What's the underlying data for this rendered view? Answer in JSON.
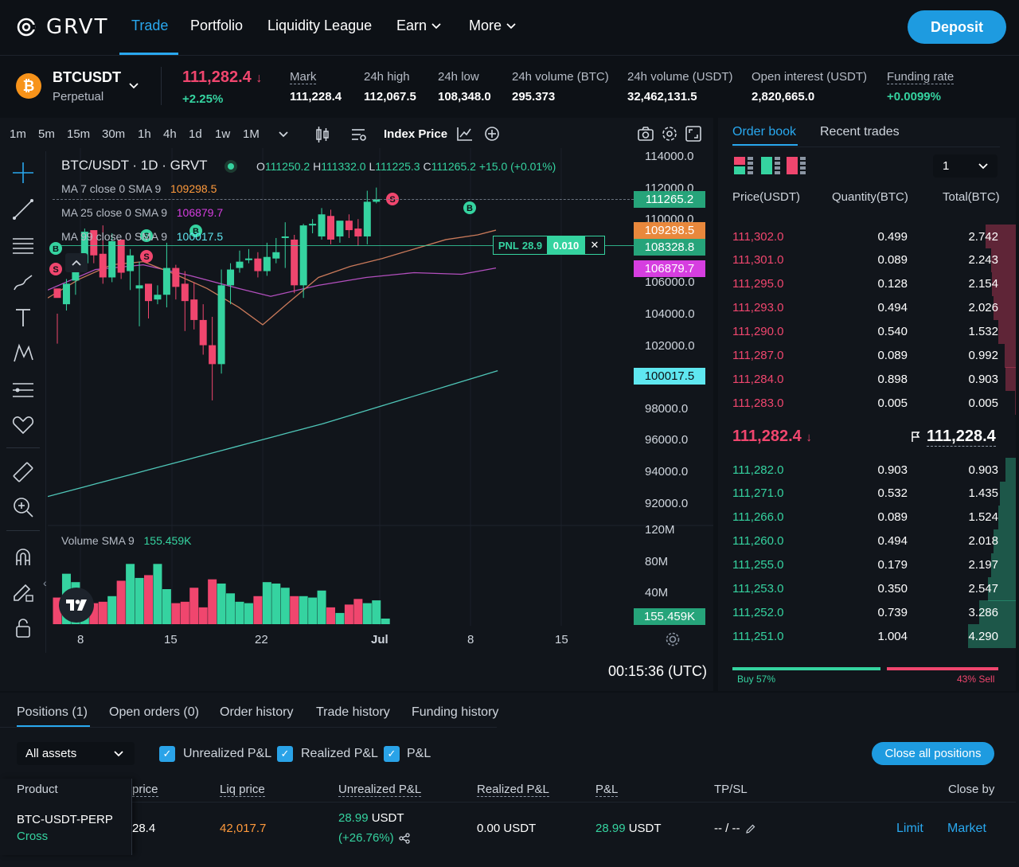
{
  "nav": {
    "logo": "GRVT",
    "items": [
      {
        "label": "Trade",
        "active": true
      },
      {
        "label": "Portfolio"
      },
      {
        "label": "Liquidity League"
      },
      {
        "label": "Earn",
        "dropdown": true
      },
      {
        "label": "More",
        "dropdown": true
      }
    ],
    "deposit": "Deposit"
  },
  "ticker": {
    "symbol": "BTCUSDT",
    "type": "Perpetual",
    "price": "111,282.4",
    "change": "+2.25%",
    "stats": [
      {
        "label": "Mark",
        "value": "111,228.4"
      },
      {
        "label": "24h high",
        "value": "112,067.5"
      },
      {
        "label": "24h low",
        "value": "108,348.0"
      },
      {
        "label": "24h volume (BTC)",
        "value": "295.373"
      },
      {
        "label": "24h volume (USDT)",
        "value": "32,462,131.5"
      },
      {
        "label": "Open interest (USDT)",
        "value": "2,820,665.0"
      },
      {
        "label": "Funding rate",
        "value": "+0.0099%"
      }
    ]
  },
  "chart": {
    "timeframes": [
      "1m",
      "5m",
      "15m",
      "30m",
      "1h",
      "4h",
      "1d",
      "1w",
      "1M"
    ],
    "active_tf": "1d",
    "index_price": "Index Price",
    "legend_title": "BTC/USDT · 1D · GRVT",
    "ohlc": {
      "o_label": "O",
      "o": "111250.2",
      "h_label": "H",
      "h": "111332.0",
      "l_label": "L",
      "l": "111225.3",
      "c_label": "C",
      "c": "111265.2",
      "chg": "+15.0 (+0.01%)"
    },
    "ma1": {
      "label": "MA 7 close 0 SMA 9",
      "value": "109298.5"
    },
    "ma2": {
      "label": "MA 25 close 0 SMA 9",
      "value": "106879.7"
    },
    "ma3": {
      "label": "MA 99 close 0 SMA 9",
      "value": "100017.5"
    },
    "price_axis": [
      "114000.0",
      "112000.0",
      "110000.0",
      "108000.0",
      "106000.0",
      "104000.0",
      "102000.0",
      "100000.0",
      "98000.0",
      "96000.0",
      "94000.0",
      "92000.0"
    ],
    "price_tags": {
      "last": "111265.2",
      "ma7": "109298.5",
      "pos": "108328.8",
      "ma25": "106879.7",
      "ma99": "100017.5"
    },
    "pnl": {
      "label": "PNL",
      "value": "28.9",
      "qty": "0.010",
      "close": "✕"
    },
    "volume_label": "Volume SMA 9",
    "volume_value": "155.459K",
    "vol_axis": [
      "120M",
      "80M",
      "40M"
    ],
    "vol_tag": "155.459K",
    "time_axis": [
      "8",
      "15",
      "22",
      "Jul",
      "8",
      "15"
    ],
    "clock": "00:15:36 (UTC)",
    "markers": {
      "s": "S",
      "b": "B"
    }
  },
  "orderbook": {
    "tabs": [
      "Order book",
      "Recent trades"
    ],
    "precision": "1",
    "headers": [
      "Price(USDT)",
      "Quantity(BTC)",
      "Total(BTC)"
    ],
    "asks": [
      {
        "p": "111,302.0",
        "q": "0.499",
        "t": "2.742",
        "depth": 0.64
      },
      {
        "p": "111,301.0",
        "q": "0.089",
        "t": "2.243",
        "depth": 0.52
      },
      {
        "p": "111,295.0",
        "q": "0.128",
        "t": "2.154",
        "depth": 0.5
      },
      {
        "p": "111,293.0",
        "q": "0.494",
        "t": "2.026",
        "depth": 0.47
      },
      {
        "p": "111,290.0",
        "q": "0.540",
        "t": "1.532",
        "depth": 0.36
      },
      {
        "p": "111,287.0",
        "q": "0.089",
        "t": "0.992",
        "depth": 0.23
      },
      {
        "p": "111,284.0",
        "q": "0.898",
        "t": "0.903",
        "depth": 0.21
      },
      {
        "p": "111,283.0",
        "q": "0.005",
        "t": "0.005",
        "depth": 0.01
      }
    ],
    "mid_price": "111,282.4",
    "mark_price": "111,228.4",
    "bids": [
      {
        "p": "111,282.0",
        "q": "0.903",
        "t": "0.903",
        "depth": 0.21
      },
      {
        "p": "111,271.0",
        "q": "0.532",
        "t": "1.435",
        "depth": 0.33
      },
      {
        "p": "111,266.0",
        "q": "0.089",
        "t": "1.524",
        "depth": 0.36
      },
      {
        "p": "111,260.0",
        "q": "0.494",
        "t": "2.018",
        "depth": 0.47
      },
      {
        "p": "111,255.0",
        "q": "0.179",
        "t": "2.197",
        "depth": 0.51
      },
      {
        "p": "111,253.0",
        "q": "0.350",
        "t": "2.547",
        "depth": 0.59
      },
      {
        "p": "111,252.0",
        "q": "0.739",
        "t": "3.286",
        "depth": 0.77
      },
      {
        "p": "111,251.0",
        "q": "1.004",
        "t": "4.290",
        "depth": 1.0
      }
    ],
    "buy_pct": "Buy 57%",
    "sell_pct": "43% Sell",
    "buy_ratio": 0.57
  },
  "positions": {
    "tabs": [
      "Positions (1)",
      "Open orders (0)",
      "Order history",
      "Trade history",
      "Funding history"
    ],
    "asset_filter": "All assets",
    "checks": [
      "Unrealized P&L",
      "Realized P&L",
      "P&L"
    ],
    "close_all": "Close all positions",
    "columns": [
      "Product",
      "price",
      "Liq price",
      "Unrealized P&L",
      "Realized P&L",
      "P&L",
      "TP/SL",
      "Close by"
    ],
    "row": {
      "product": "BTC-USDT-PERP",
      "margin": "Cross",
      "price": "28.4",
      "liq": "42,017.7",
      "upnl": "28.99",
      "upnl_unit": "USDT",
      "upnl_pct": "(+26.76%)",
      "rpnl": "0.00 USDT",
      "pnl": "28.99",
      "pnl_unit": "USDT",
      "tpsl": "-- / --",
      "limit": "Limit",
      "market": "Market"
    }
  },
  "colors": {
    "green": "#35d3a0",
    "red": "#f0466e",
    "accent": "#29a8ef",
    "orange": "#ff9a3c",
    "magenta": "#d63ee0",
    "cyan": "#5fe7f0"
  }
}
